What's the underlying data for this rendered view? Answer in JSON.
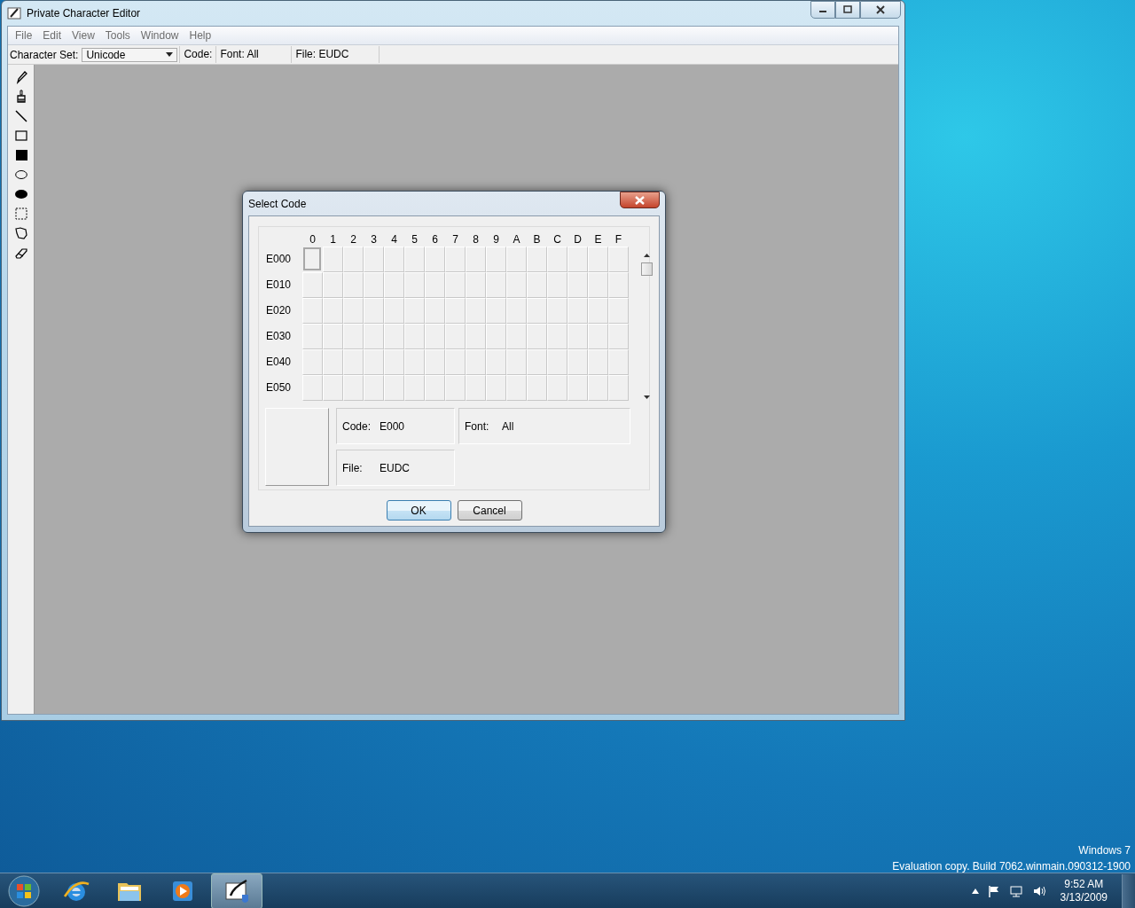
{
  "window": {
    "title": "Private Character Editor"
  },
  "menu": [
    "File",
    "Edit",
    "View",
    "Tools",
    "Window",
    "Help"
  ],
  "toolbar": {
    "charset_label": "Character Set:",
    "charset_value": "Unicode",
    "code_label": "Code:",
    "font_label": "Font: All",
    "file_label": "File: EUDC"
  },
  "tools": [
    {
      "kind": "pencil"
    },
    {
      "kind": "brush"
    },
    {
      "kind": "line"
    },
    {
      "kind": "rect"
    },
    {
      "kind": "filled-rect"
    },
    {
      "kind": "ellipse"
    },
    {
      "kind": "filled-ellipse"
    },
    {
      "kind": "select-rect"
    },
    {
      "kind": "freeform"
    },
    {
      "kind": "eraser"
    }
  ],
  "dialog": {
    "title": "Select Code",
    "columns": [
      "0",
      "1",
      "2",
      "3",
      "4",
      "5",
      "6",
      "7",
      "8",
      "9",
      "A",
      "B",
      "C",
      "D",
      "E",
      "F"
    ],
    "rows": [
      {
        "label": "E000",
        "cells": [
          {
            "selected": true
          },
          {
            "selected": false
          },
          {
            "selected": false
          },
          {
            "selected": false
          },
          {
            "selected": false
          },
          {
            "selected": false
          },
          {
            "selected": false
          },
          {
            "selected": false
          },
          {
            "selected": false
          },
          {
            "selected": false
          },
          {
            "selected": false
          },
          {
            "selected": false
          },
          {
            "selected": false
          },
          {
            "selected": false
          },
          {
            "selected": false
          },
          {
            "selected": false
          }
        ]
      },
      {
        "label": "E010",
        "cells": [
          {
            "selected": false
          },
          {
            "selected": false
          },
          {
            "selected": false
          },
          {
            "selected": false
          },
          {
            "selected": false
          },
          {
            "selected": false
          },
          {
            "selected": false
          },
          {
            "selected": false
          },
          {
            "selected": false
          },
          {
            "selected": false
          },
          {
            "selected": false
          },
          {
            "selected": false
          },
          {
            "selected": false
          },
          {
            "selected": false
          },
          {
            "selected": false
          },
          {
            "selected": false
          }
        ]
      },
      {
        "label": "E020",
        "cells": [
          {
            "selected": false
          },
          {
            "selected": false
          },
          {
            "selected": false
          },
          {
            "selected": false
          },
          {
            "selected": false
          },
          {
            "selected": false
          },
          {
            "selected": false
          },
          {
            "selected": false
          },
          {
            "selected": false
          },
          {
            "selected": false
          },
          {
            "selected": false
          },
          {
            "selected": false
          },
          {
            "selected": false
          },
          {
            "selected": false
          },
          {
            "selected": false
          },
          {
            "selected": false
          }
        ]
      },
      {
        "label": "E030",
        "cells": [
          {
            "selected": false
          },
          {
            "selected": false
          },
          {
            "selected": false
          },
          {
            "selected": false
          },
          {
            "selected": false
          },
          {
            "selected": false
          },
          {
            "selected": false
          },
          {
            "selected": false
          },
          {
            "selected": false
          },
          {
            "selected": false
          },
          {
            "selected": false
          },
          {
            "selected": false
          },
          {
            "selected": false
          },
          {
            "selected": false
          },
          {
            "selected": false
          },
          {
            "selected": false
          }
        ]
      },
      {
        "label": "E040",
        "cells": [
          {
            "selected": false
          },
          {
            "selected": false
          },
          {
            "selected": false
          },
          {
            "selected": false
          },
          {
            "selected": false
          },
          {
            "selected": false
          },
          {
            "selected": false
          },
          {
            "selected": false
          },
          {
            "selected": false
          },
          {
            "selected": false
          },
          {
            "selected": false
          },
          {
            "selected": false
          },
          {
            "selected": false
          },
          {
            "selected": false
          },
          {
            "selected": false
          },
          {
            "selected": false
          }
        ]
      },
      {
        "label": "E050",
        "cells": [
          {
            "selected": false
          },
          {
            "selected": false
          },
          {
            "selected": false
          },
          {
            "selected": false
          },
          {
            "selected": false
          },
          {
            "selected": false
          },
          {
            "selected": false
          },
          {
            "selected": false
          },
          {
            "selected": false
          },
          {
            "selected": false
          },
          {
            "selected": false
          },
          {
            "selected": false
          },
          {
            "selected": false
          },
          {
            "selected": false
          },
          {
            "selected": false
          },
          {
            "selected": false
          }
        ]
      }
    ],
    "info": {
      "code_label": "Code:",
      "code_value": "E000",
      "font_label": "Font:",
      "font_value": "All",
      "file_label": "File:",
      "file_value": "EUDC"
    },
    "buttons": [
      {
        "label": "OK",
        "default": true
      },
      {
        "label": "Cancel",
        "default": false
      }
    ]
  },
  "desktop": {
    "edition": "Windows 7",
    "build": "Evaluation copy. Build 7062.winmain.090312-1900"
  },
  "taskbar": {
    "apps": [
      {
        "kind": "browser",
        "active": false
      },
      {
        "kind": "folder",
        "active": false
      },
      {
        "kind": "media",
        "active": false
      },
      {
        "kind": "editor",
        "active": true
      }
    ],
    "time": "9:52 AM",
    "date": "3/13/2009"
  }
}
